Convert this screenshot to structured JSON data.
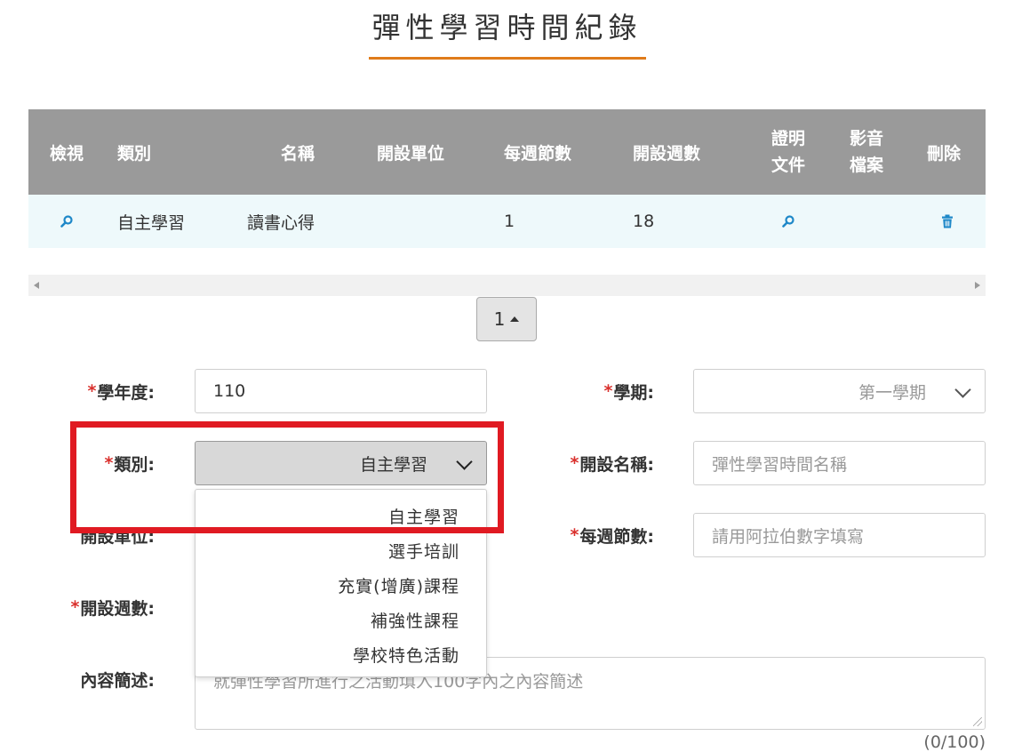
{
  "page": {
    "title": "彈性學習時間紀錄"
  },
  "table": {
    "headers": {
      "view": "檢視",
      "category": "類別",
      "name": "名稱",
      "unit": "開設單位",
      "per_week": "每週節數",
      "weeks": "開設週數",
      "proof_1": "證明",
      "proof_2": "文件",
      "media_1": "影音",
      "media_2": "檔案",
      "delete": "刪除"
    },
    "rows": [
      {
        "category": "自主學習",
        "name": "讀書心得",
        "unit": "",
        "per_week": "1",
        "weeks": "18"
      }
    ]
  },
  "pager": {
    "page": "1"
  },
  "form": {
    "year_label": "學年度:",
    "year_value": "110",
    "semester_label": "學期:",
    "semester_value": "第一學期",
    "category_label": "類別:",
    "category_value": "自主學習",
    "course_name_label": "開設名稱:",
    "course_name_placeholder": "彈性學習時間名稱",
    "unit_label": "開設單位:",
    "per_week_label": "每週節數:",
    "per_week_placeholder": "請用阿拉伯數字填寫",
    "weeks_label": "開設週數:",
    "desc_label": "內容簡述:",
    "desc_placeholder": "就彈性學習所進行之活動填入100字內之內容簡述",
    "desc_counter": "(0/100)",
    "required_mark": "*"
  },
  "dropdown": {
    "options": [
      "自主學習",
      "選手培訓",
      "充實(增廣)課程",
      "補強性課程",
      "學校特色活動"
    ]
  },
  "colors": {
    "accent": "#e07b1a",
    "header_bg": "#9a9a9a",
    "row_bg": "#eef9fb",
    "icon": "#1e88c8",
    "required": "#d9302c",
    "highlight": "#e01a22"
  }
}
